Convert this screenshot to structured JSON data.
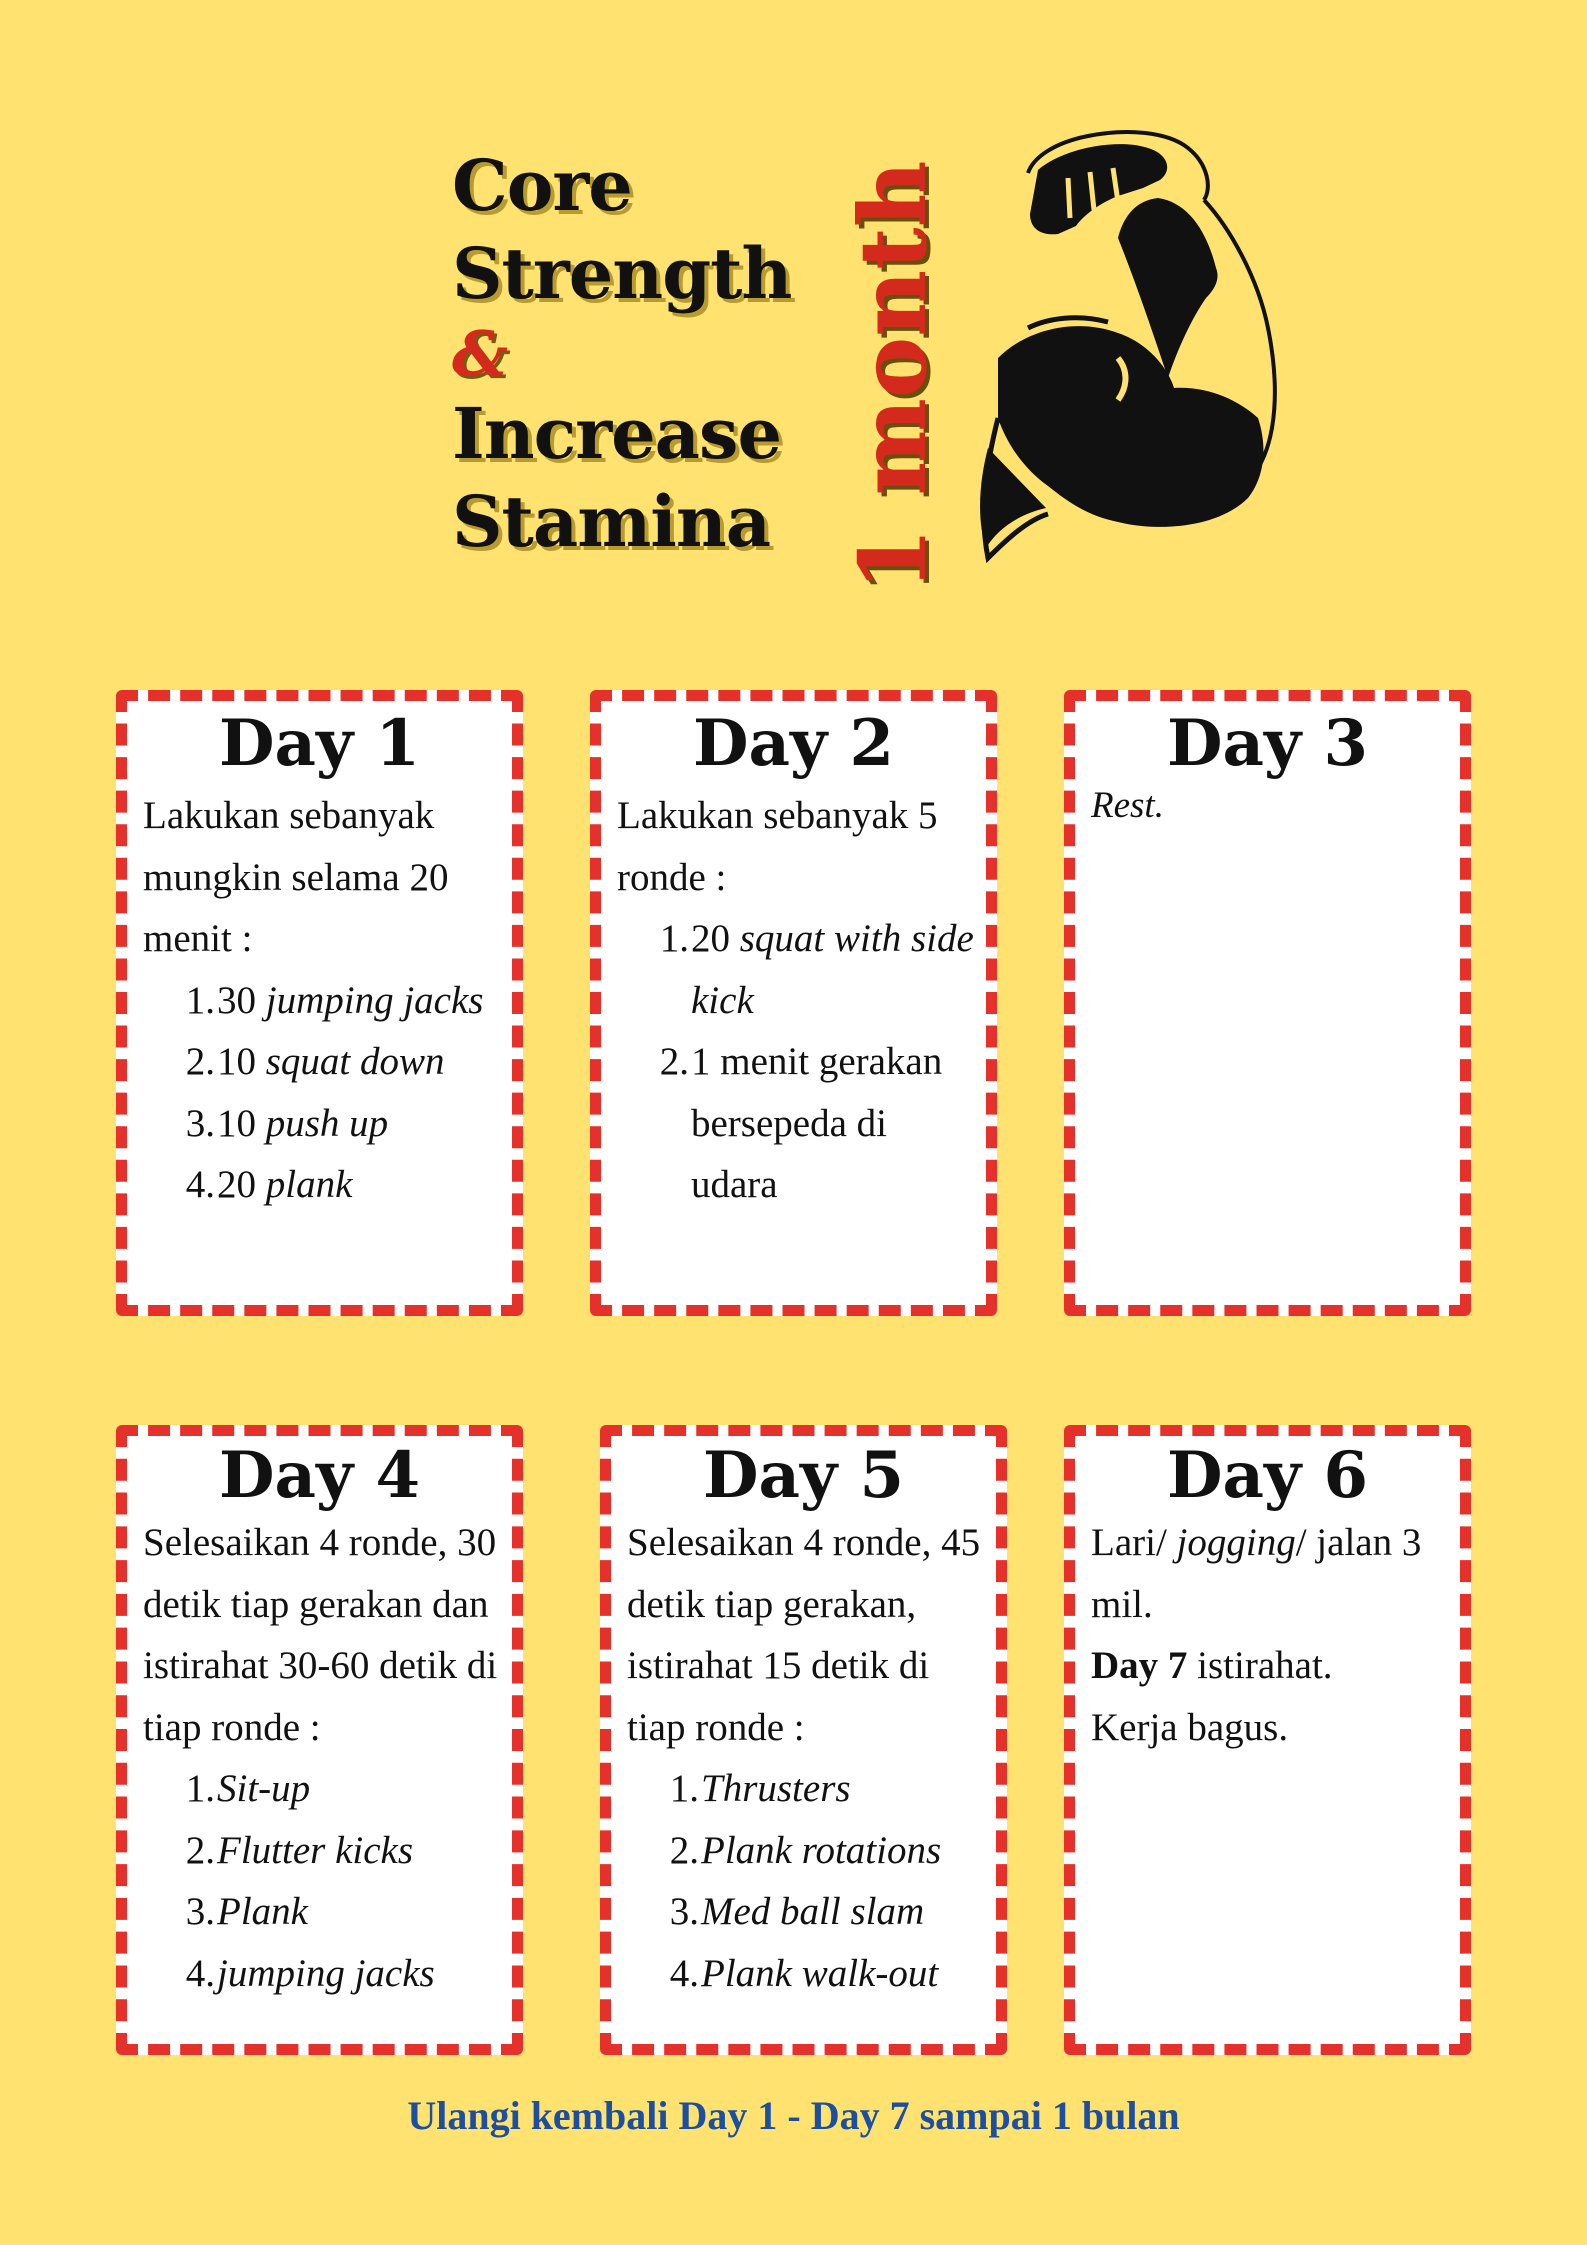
{
  "title": {
    "line1": "Core",
    "line2": "Strength",
    "amp": "&",
    "line3": "Increase",
    "line4": "Stamina",
    "vertical": "1 month"
  },
  "icons": {
    "arm": "flexed-bicep-icon"
  },
  "colors": {
    "background": "#ffe270",
    "border": "#e5312c",
    "accent_red": "#d42a1e",
    "footer_blue": "#1c4fa0"
  },
  "days": [
    {
      "title": "Day 1",
      "intro": "Lakukan sebanyak mungkin selama 20 menit :",
      "items": [
        {
          "num": "1.",
          "count": "30 ",
          "name": "jumping jacks"
        },
        {
          "num": "2.",
          "count": "10 ",
          "name": "squat down"
        },
        {
          "num": "3.",
          "count": "10 ",
          "name": "push up"
        },
        {
          "num": "4.",
          "count": "20 ",
          "name": "plank"
        }
      ]
    },
    {
      "title": "Day 2",
      "intro": "Lakukan sebanyak 5 ronde :",
      "items": [
        {
          "num": "1.",
          "count": "20 ",
          "name": "squat with side kick"
        },
        {
          "num": "2.",
          "count": "1 menit gerakan bersepeda di udara",
          "name": ""
        }
      ]
    },
    {
      "title": "Day 3",
      "intro": "Rest."
    },
    {
      "title": "Day 4",
      "intro": "Selesaikan 4 ronde, 30 detik tiap gerakan dan istirahat 30-60 detik di tiap ronde :",
      "items": [
        {
          "num": "1.",
          "name": "Sit-up"
        },
        {
          "num": "2.",
          "name": "Flutter kicks"
        },
        {
          "num": "3.",
          "name": "Plank"
        },
        {
          "num": "4.",
          "name": "jumping jacks"
        }
      ]
    },
    {
      "title": "Day 5",
      "intro": "Selesaikan 4 ronde, 45 detik tiap gerakan, istirahat 15 detik di tiap ronde :",
      "items": [
        {
          "num": "1.",
          "name": "Thrusters"
        },
        {
          "num": "2.",
          "name": "Plank rotations"
        },
        {
          "num": "3.",
          "name": "Med ball slam"
        },
        {
          "num": "4.",
          "name": "Plank walk-out"
        }
      ]
    },
    {
      "title": "Day 6",
      "run_prefix": "Lari/ ",
      "run_italic": "jogging",
      "run_suffix": "/ jalan 3 mil.",
      "day7_bold": "Day 7",
      "day7_rest": " istirahat.",
      "closing": "Kerja bagus."
    }
  ],
  "footer": "Ulangi kembali Day 1 - Day 7 sampai 1 bulan"
}
